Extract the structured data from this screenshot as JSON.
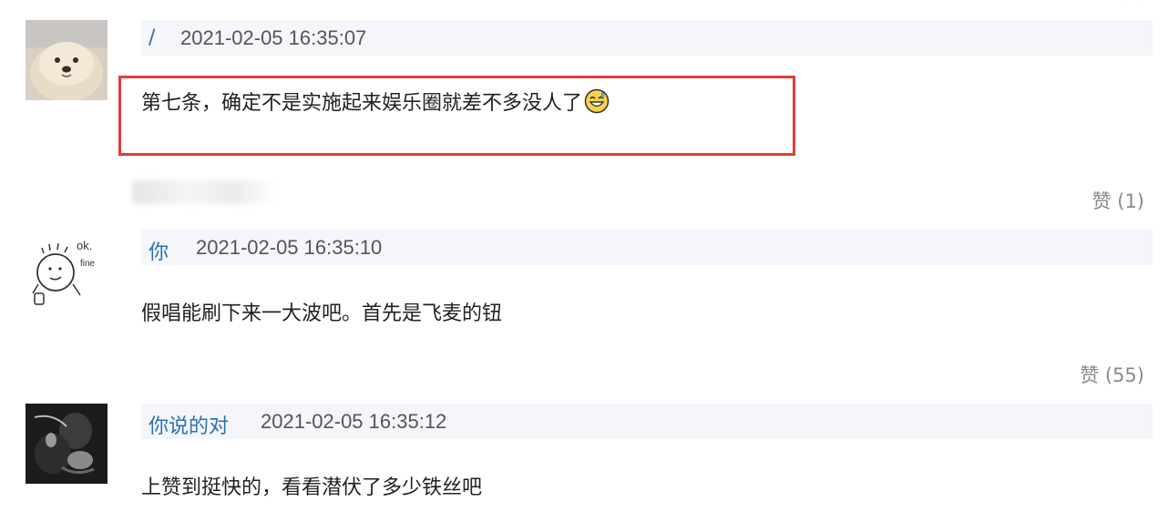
{
  "comments": [
    {
      "username": "/",
      "timestamp": "2021-02-05 16:35:07",
      "text": "第七条，确定不是实施起来娱乐圈就差不多没人了",
      "emoji": "grinning-sweat-emoji",
      "likes": "赞 (1)",
      "avatar": "fluffy-dog-avatar"
    },
    {
      "username": "你",
      "timestamp": "2021-02-05 16:35:10",
      "text": "假唱能刷下来一大波吧。首先是飞麦的钮",
      "likes": "赞 (55)",
      "avatar": "ok-fine-doodle-avatar",
      "avatar_text_1": "ok.",
      "avatar_text_2": "fine"
    },
    {
      "username": "你说的对",
      "timestamp": "2021-02-05 16:35:12",
      "text": "上赞到挺快的，看看潜伏了多少铁丝吧",
      "avatar": "dark-photo-avatar"
    }
  ],
  "colors": {
    "username": "#2e6fb0",
    "highlight": "#e43a3a",
    "header_bg": "#f4f6f9"
  }
}
